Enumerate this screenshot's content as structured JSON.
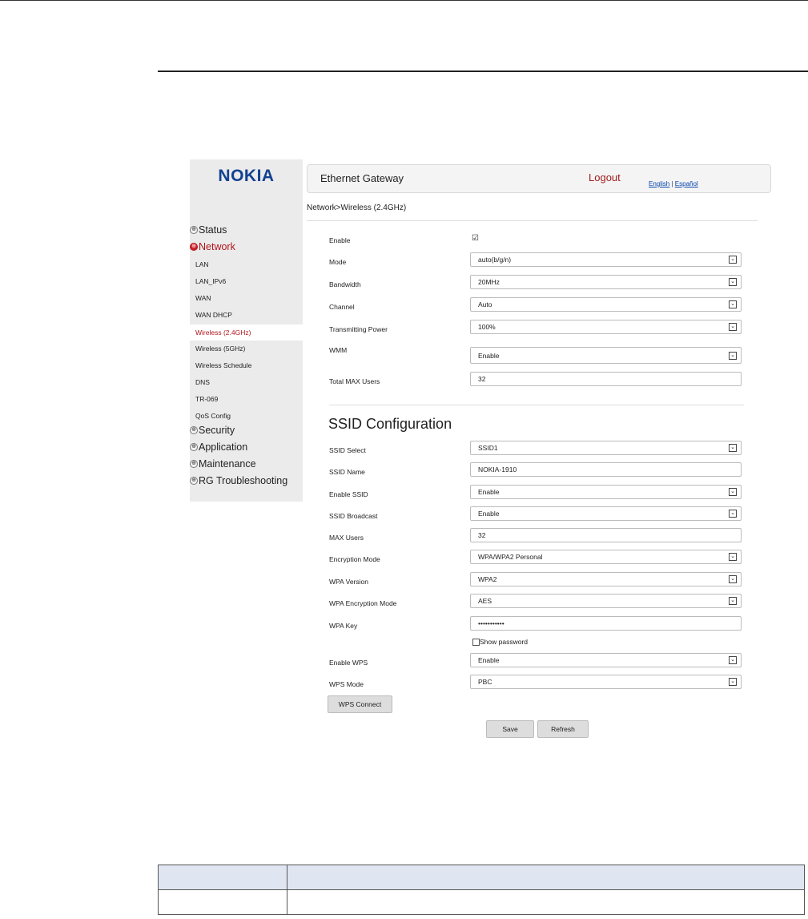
{
  "app": {
    "logo": "NOKIA",
    "title": "Ethernet Gateway",
    "logout": "Logout",
    "lang_en": "English",
    "lang_sep": "|",
    "lang_es": "Español"
  },
  "breadcrumb": "Network>Wireless (2.4GHz)",
  "nav": {
    "status": "Status",
    "network": "Network",
    "subs": [
      "LAN",
      "LAN_IPv6",
      "WAN",
      "WAN DHCP",
      "Wireless (2.4GHz)",
      "Wireless (5GHz)",
      "Wireless Schedule",
      "DNS",
      "TR-069",
      "QoS Config"
    ],
    "security": "Security",
    "application": "Application",
    "maintenance": "Maintenance",
    "rg": "RG Troubleshooting"
  },
  "wireless": {
    "enable_label": "Enable",
    "enable_check": "☑",
    "mode_label": "Mode",
    "mode_value": "auto(b/g/n)",
    "bandwidth_label": "Bandwidth",
    "bandwidth_value": "20MHz",
    "channel_label": "Channel",
    "channel_value": "Auto",
    "power_label": "Transmitting Power",
    "power_value": "100%",
    "wmm_label": "WMM",
    "wmm_value": "Enable",
    "max_users_label": "Total MAX Users",
    "max_users_value": "32"
  },
  "ssid": {
    "title": "SSID Configuration",
    "select_label": "SSID Select",
    "select_value": "SSID1",
    "name_label": "SSID Name",
    "name_value": "NOKIA-1910",
    "enable_label": "Enable SSID",
    "enable_value": "Enable",
    "broadcast_label": "SSID Broadcast",
    "broadcast_value": "Enable",
    "max_users_label": "MAX Users",
    "max_users_value": "32",
    "enc_mode_label": "Encryption Mode",
    "enc_mode_value": "WPA/WPA2 Personal",
    "wpa_version_label": "WPA Version",
    "wpa_version_value": "WPA2",
    "wpa_enc_label": "WPA Encryption Mode",
    "wpa_enc_value": "AES",
    "wpa_key_label": "WPA Key",
    "wpa_key_value": "•••••••••••",
    "show_password": "Show password",
    "wps_label": "Enable WPS",
    "wps_value": "Enable",
    "wps_mode_label": "WPS Mode",
    "wps_mode_value": "PBC",
    "wps_connect": "WPS Connect",
    "save": "Save",
    "refresh": "Refresh"
  },
  "icons": {
    "expand": "⊕",
    "dropdown": "⌄"
  },
  "colors": {
    "brand": "#124191",
    "accent_red": "#b2141b",
    "link": "#0645ad"
  }
}
